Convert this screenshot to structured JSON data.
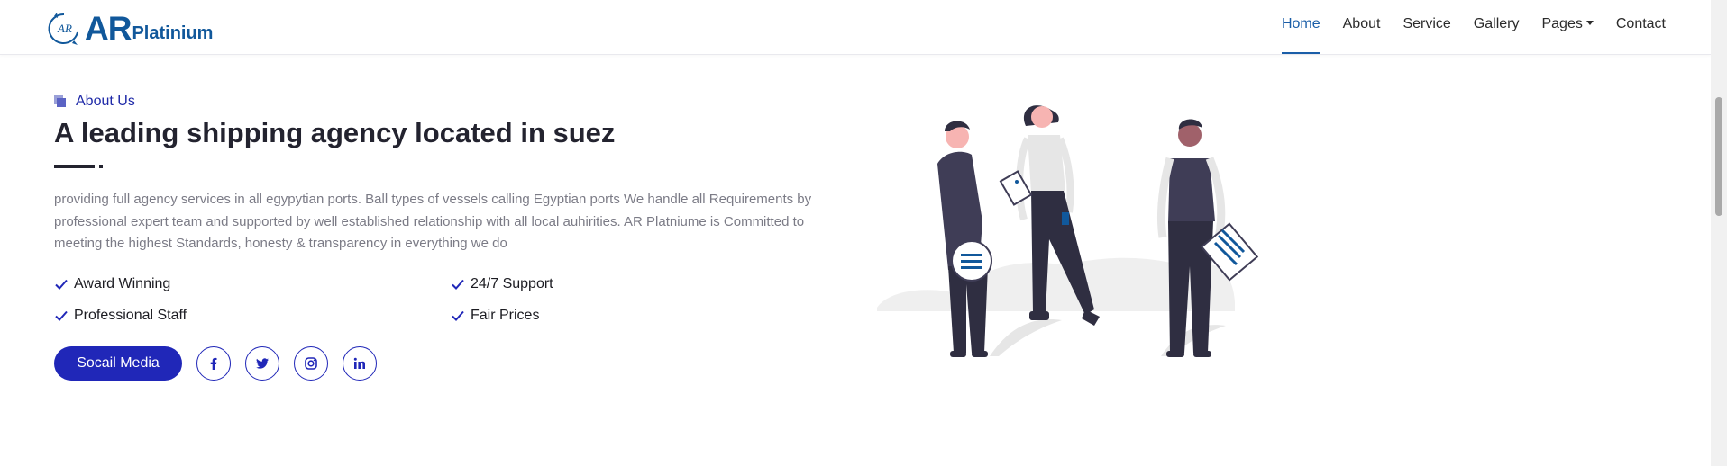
{
  "brand": {
    "logo_text": "AR",
    "name_main": "AR",
    "name_sub": "Platinium"
  },
  "nav": {
    "items": [
      {
        "label": "Home",
        "active": true
      },
      {
        "label": "About"
      },
      {
        "label": "Service"
      },
      {
        "label": "Gallery"
      },
      {
        "label": "Pages",
        "has_dropdown": true
      },
      {
        "label": "Contact"
      }
    ]
  },
  "about": {
    "eyebrow": "About Us",
    "title": "A leading shipping agency located in suez",
    "description": "providing full agency services in all egypytian ports. Ball types of vessels calling Egyptian ports We handle all Requirements by professional expert team and supported by well established relationship with all local auhirities. AR Platniume is Committed to meeting the highest Standards, honesty & transparency in everything we do",
    "features": [
      "Award Winning",
      "24/7 Support",
      "Professional Staff",
      "Fair Prices"
    ],
    "social_button": "Socail Media",
    "social_icons": [
      "facebook-icon",
      "twitter-icon",
      "instagram-icon",
      "linkedin-icon"
    ]
  },
  "colors": {
    "accent": "#2027b8",
    "brand": "#11589b",
    "nav_active": "#1a5ea8",
    "heading": "#23232f",
    "body_text": "#7b7b86"
  }
}
